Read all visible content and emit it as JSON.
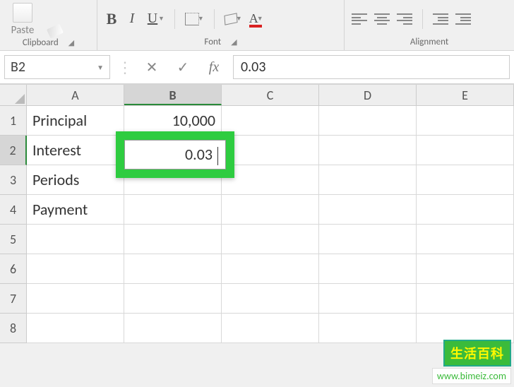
{
  "ribbon": {
    "clipboard": {
      "paste_label": "Paste",
      "group_label": "Clipboard"
    },
    "font": {
      "bold": "B",
      "italic": "I",
      "underline": "U",
      "fontcolor_glyph": "A",
      "group_label": "Font"
    },
    "alignment": {
      "group_label": "Alignment"
    }
  },
  "formula_bar": {
    "name_box": "B2",
    "cancel_glyph": "✕",
    "enter_glyph": "✓",
    "fx_glyph": "fx",
    "formula_value": "0.03"
  },
  "columns": [
    "A",
    "B",
    "C",
    "D",
    "E"
  ],
  "rows": [
    "1",
    "2",
    "3",
    "4",
    "5",
    "6",
    "7",
    "8"
  ],
  "cells": {
    "A1": "Principal",
    "B1": "10,000",
    "A2": "Interest",
    "B2_edit": "0.03",
    "A3": "Periods",
    "A4": "Payment"
  },
  "selection": {
    "col": "B",
    "row": "2"
  },
  "watermark": {
    "logo": "生活百科",
    "url": "www.bimeiz.com"
  }
}
